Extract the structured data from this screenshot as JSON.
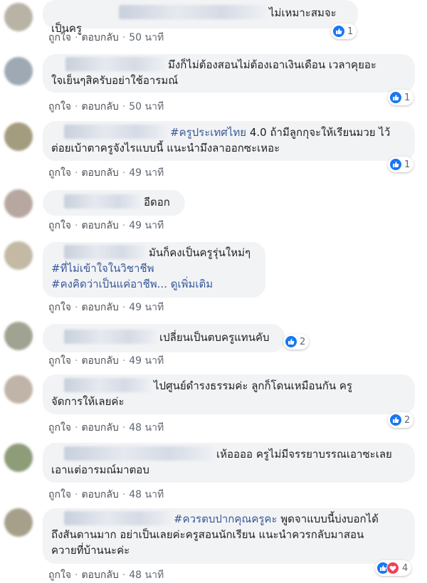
{
  "actions": {
    "like": "ถูกใจ",
    "reply": "ตอบกลับ",
    "separator": "·"
  },
  "comments": [
    {
      "text": "ไม่เหมาะสมจะเป็นครู",
      "time": "50 นาที",
      "reactions": "1"
    },
    {
      "text_line1": "มึงก็ไม่ต้องสอนไม่ต้องเอาเงินเดือน เวลาคุยอะ",
      "text_line2": "ใจเย็นๆสิครับอย่าใช้อารมณ์",
      "time": "50 นาที",
      "reactions": "1"
    },
    {
      "tag": "#ครูประเทศไทย",
      "text_line1": " 4.0 ถ้ามีลูกกุจะให้เรียนมวย ไว้",
      "text_line2": "ต่อยเบ้าตาครูจังไรแบบนี้ แนะนำมึงลาออกซะเหอะ",
      "time": "49 นาที",
      "reactions": "1"
    },
    {
      "text": "อีดอก",
      "time": "49 นาที"
    },
    {
      "text": "มันก็คงเป็นครูรุ่นใหม่ๆ",
      "tag2": "#ที่ไม่เข้าใจในวิชาชีพ",
      "tag3": "#คงคิดว่าเป็นแค่อาชีพ...",
      "more": "ดูเพิ่มเติม",
      "time": "49 นาที"
    },
    {
      "text": "เปลี่ยนเป็นตบครูแทนคับ",
      "time": "49 นาที",
      "reactions": "2"
    },
    {
      "text_line1": "ไปศูนย์ดำรงธรรมค่ะ ลูกก็โดนเหมือนกัน ครู",
      "text_line2": "จัดการให้เลยค่ะ",
      "time": "48 นาที",
      "reactions": "2"
    },
    {
      "text_line1": "เห้ออออ ครูไม่มีจรรยาบรรณเอาซะเลย",
      "text_line2": "เอาแต่อารมณ์มาตอบ",
      "time": "48 นาที"
    },
    {
      "tag": "#ควรตบปากคุณครูคะ",
      "text_line1": " พูดจาแบบนี้บ่งบอกได้",
      "text_line2": "ถึงสันดานมาก อย่าเป็นเลยค่ะครูสอนนักเรียน แนะนำควรกลับมาสอน",
      "text_line3": "ควายที่บ้านนะค่ะ",
      "time": "48 นาที",
      "reactions": "4"
    }
  ],
  "colors": {
    "bubble": "#f2f3f5",
    "link": "#385898",
    "like": "#1877f2",
    "love": "#f33e58",
    "meta": "#606770"
  },
  "icons": {
    "like": "thumbs-up-icon",
    "love": "heart-icon"
  }
}
